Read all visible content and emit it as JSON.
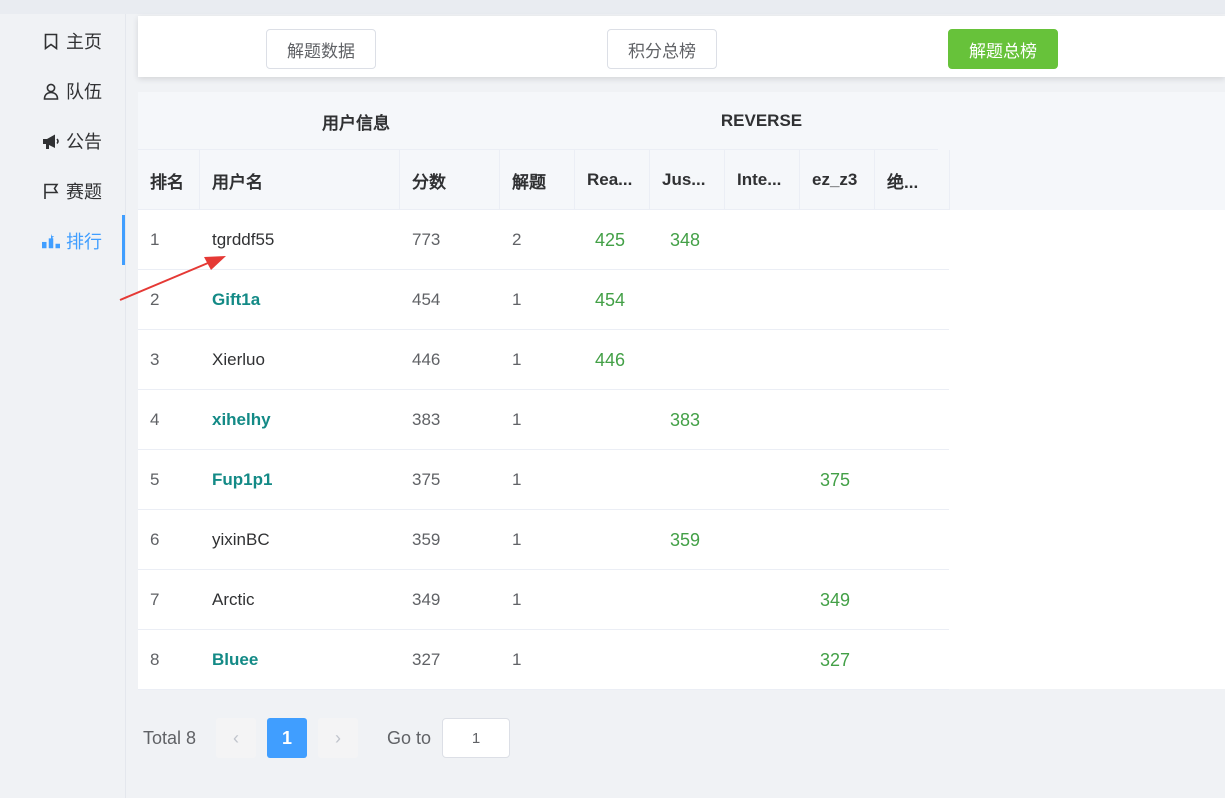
{
  "sidebar": {
    "items": [
      {
        "label": "主页",
        "icon": "bookmark-icon"
      },
      {
        "label": "队伍",
        "icon": "user-icon"
      },
      {
        "label": "公告",
        "icon": "megaphone-icon"
      },
      {
        "label": "赛题",
        "icon": "flag-icon"
      },
      {
        "label": "排行",
        "icon": "rank-icon",
        "active": true
      }
    ]
  },
  "tabs": [
    {
      "label": "解题数据"
    },
    {
      "label": "积分总榜"
    },
    {
      "label": "解题总榜",
      "active": true
    }
  ],
  "table": {
    "group_headers": [
      "用户信息",
      "REVERSE"
    ],
    "columns": [
      "排名",
      "用户名",
      "分数",
      "解题",
      "Rea...",
      "Jus...",
      "Inte...",
      "ez_z3",
      "绝..."
    ],
    "rows": [
      {
        "rank": "1",
        "user": "tgrddf55",
        "score": "773",
        "solved": "2",
        "c1": "425",
        "c2": "348",
        "c3": "",
        "c4": "",
        "c5": ""
      },
      {
        "rank": "2",
        "user": "Gift1a",
        "score": "454",
        "solved": "1",
        "c1": "454",
        "c2": "",
        "c3": "",
        "c4": "",
        "c5": ""
      },
      {
        "rank": "3",
        "user": "Xierluo",
        "score": "446",
        "solved": "1",
        "c1": "446",
        "c2": "",
        "c3": "",
        "c4": "",
        "c5": ""
      },
      {
        "rank": "4",
        "user": "xihelhy",
        "score": "383",
        "solved": "1",
        "c1": "",
        "c2": "383",
        "c3": "",
        "c4": "",
        "c5": ""
      },
      {
        "rank": "5",
        "user": "Fup1p1",
        "score": "375",
        "solved": "1",
        "c1": "",
        "c2": "",
        "c3": "",
        "c4": "375",
        "c5": ""
      },
      {
        "rank": "6",
        "user": "yixinBC",
        "score": "359",
        "solved": "1",
        "c1": "",
        "c2": "359",
        "c3": "",
        "c4": "",
        "c5": ""
      },
      {
        "rank": "7",
        "user": "Arctic",
        "score": "349",
        "solved": "1",
        "c1": "",
        "c2": "",
        "c3": "",
        "c4": "349",
        "c5": ""
      },
      {
        "rank": "8",
        "user": "Bluee",
        "score": "327",
        "solved": "1",
        "c1": "",
        "c2": "",
        "c3": "",
        "c4": "327",
        "c5": ""
      }
    ]
  },
  "pagination": {
    "total_label": "Total 8",
    "current_page": "1",
    "prev": "‹",
    "next": "›",
    "goto_label": "Go to",
    "goto_value": "1"
  },
  "colors": {
    "accent": "#409eff",
    "success": "#67c23a",
    "points": "#43a047",
    "highlight_user": "#138a86",
    "annotation_arrow": "#e53935"
  }
}
